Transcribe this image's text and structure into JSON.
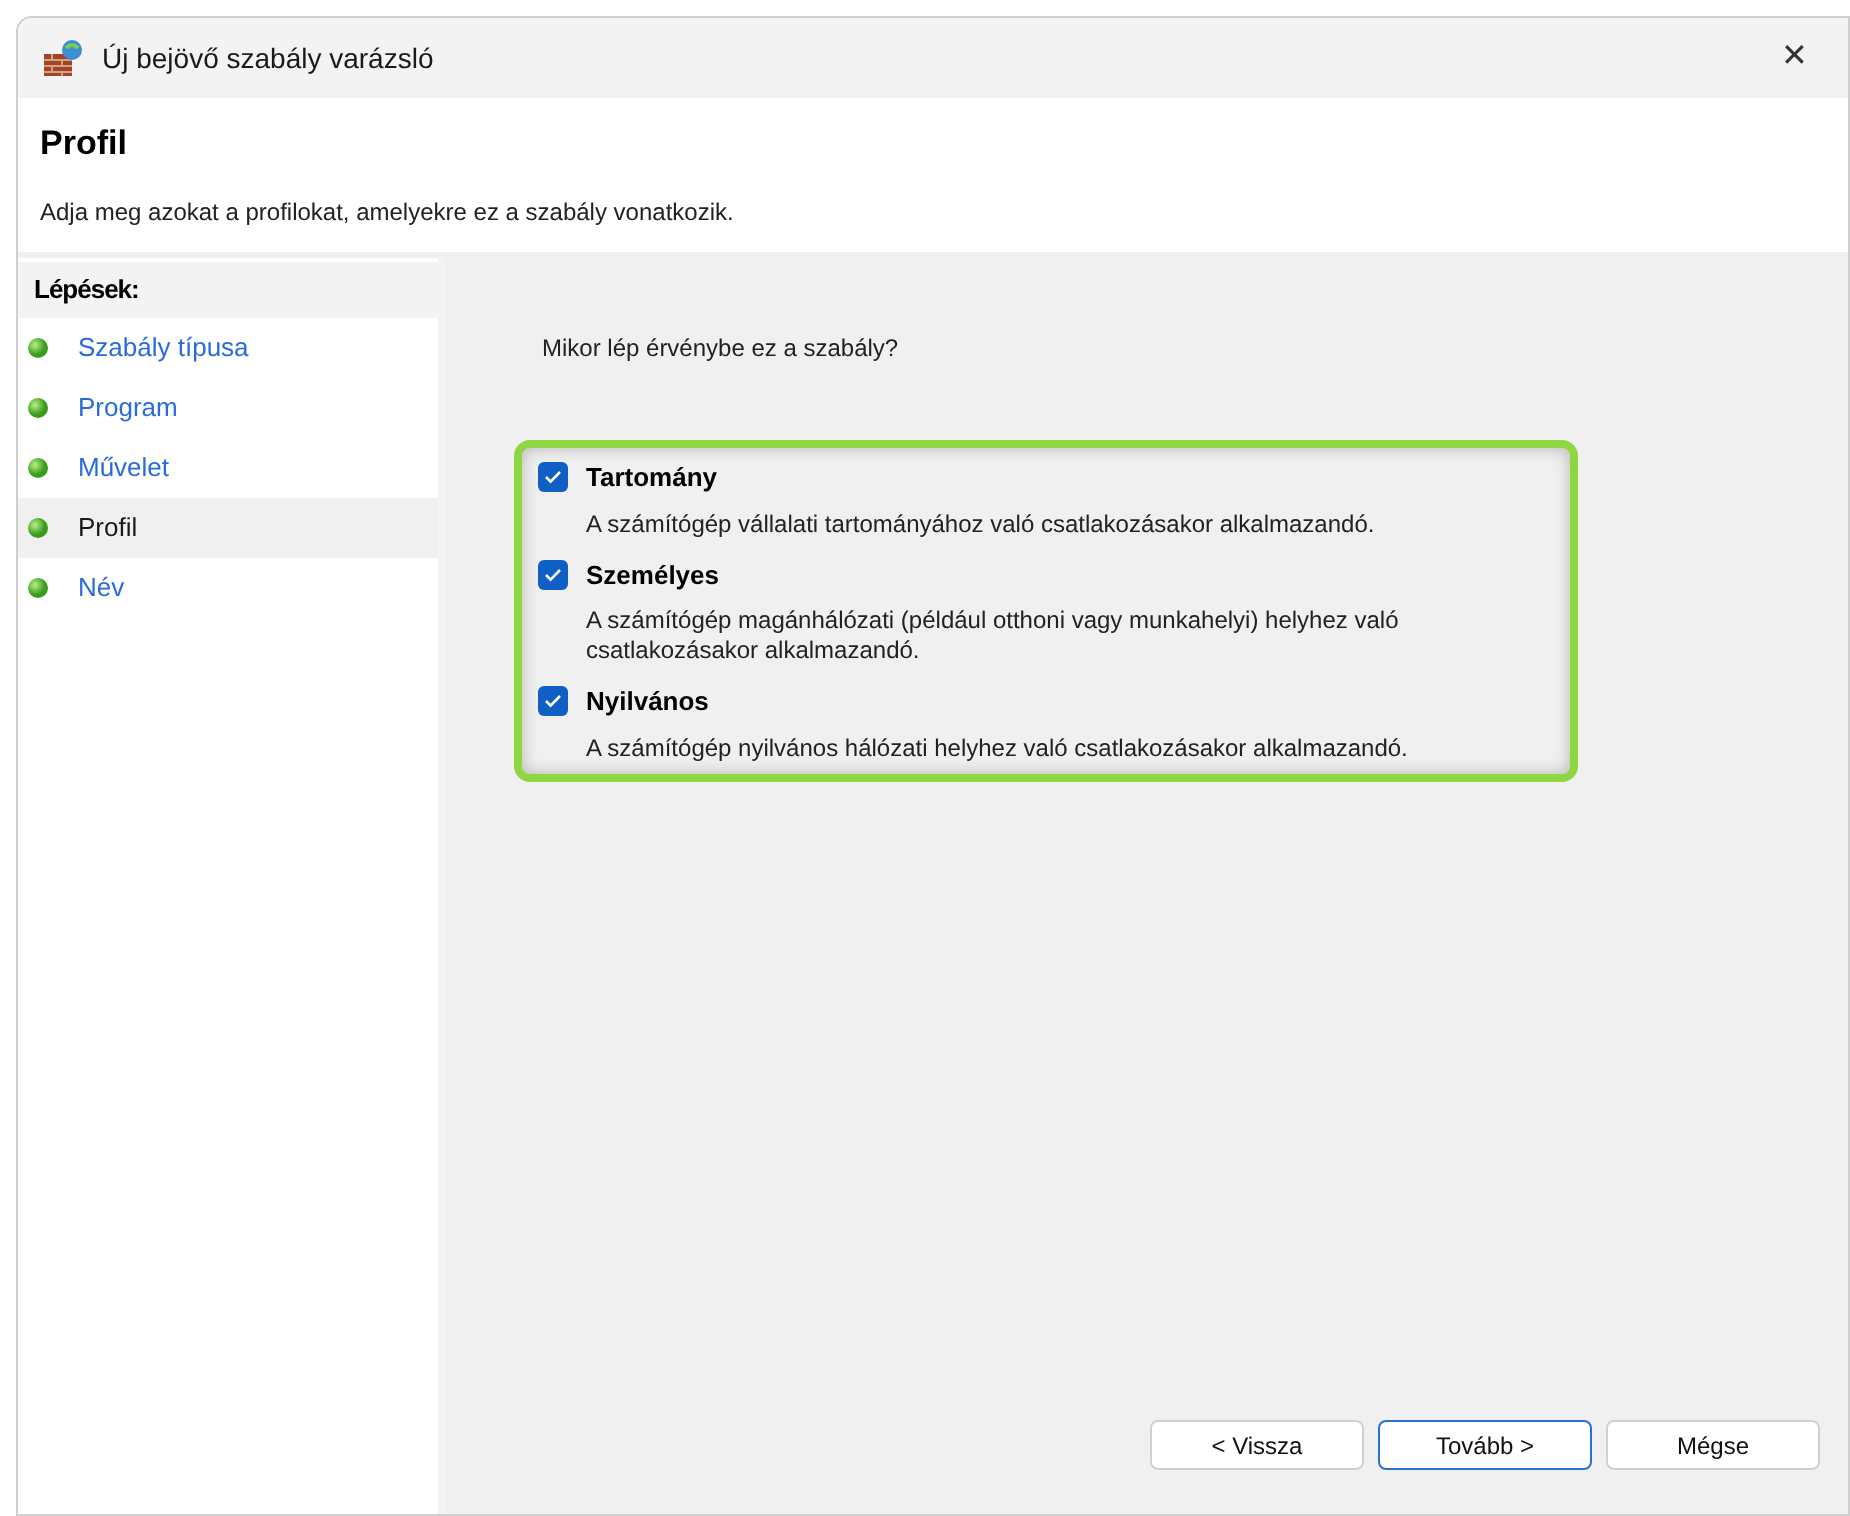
{
  "window": {
    "title": "Új bejövő szabály varázsló",
    "close": "✕"
  },
  "header": {
    "title": "Profil",
    "subtitle": "Adja meg azokat a profilokat, amelyekre ez a szabály vonatkozik."
  },
  "steps": {
    "heading": "Lépések:",
    "items": [
      {
        "label": "Szabály típusa",
        "selected": false
      },
      {
        "label": "Program",
        "selected": false
      },
      {
        "label": "Művelet",
        "selected": false
      },
      {
        "label": "Profil",
        "selected": true
      },
      {
        "label": "Név",
        "selected": false
      }
    ]
  },
  "question": "Mikor lép érvénybe ez a szabály?",
  "profiles": [
    {
      "label": "Tartomány",
      "checked": true,
      "description": "A számítógép vállalati tartományához való csatlakozásakor alkalmazandó."
    },
    {
      "label": "Személyes",
      "checked": true,
      "description": "A számítógép magánhálózati (például otthoni vagy munkahelyi) helyhez való csatlakozásakor alkalmazandó."
    },
    {
      "label": "Nyilvános",
      "checked": true,
      "description": "A számítógép nyilvános hálózati helyhez való csatlakozásakor alkalmazandó."
    }
  ],
  "buttons": [
    {
      "label": "< Vissza",
      "selected": false
    },
    {
      "label": "Tovább >",
      "selected": true
    },
    {
      "label": "Mégse",
      "selected": false
    }
  ]
}
